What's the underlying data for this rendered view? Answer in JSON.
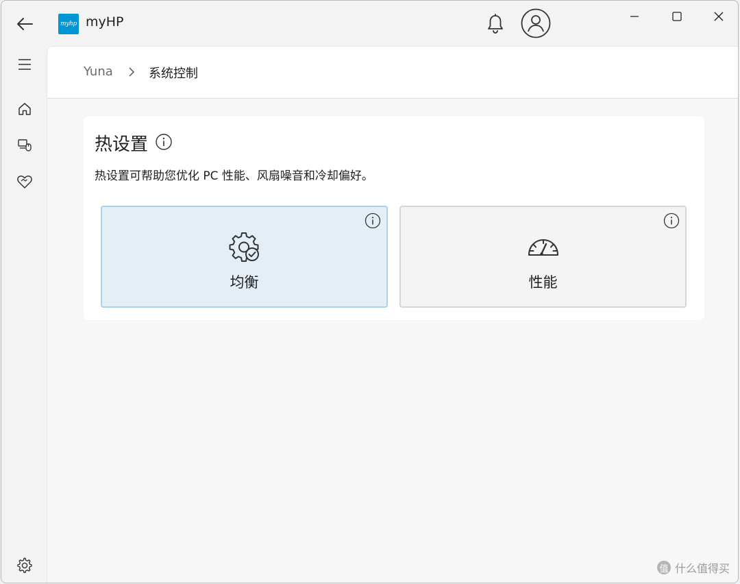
{
  "app": {
    "title": "myHP",
    "logo_text": "myhp",
    "brand_color": "#0096d6"
  },
  "titlebar": {
    "back_icon": "arrow-left-icon",
    "notification_icon": "bell-icon",
    "account_icon": "user-circle-icon",
    "window_controls": [
      "minimize-icon",
      "maximize-icon",
      "close-icon"
    ]
  },
  "sidebar": {
    "items": [
      {
        "icon": "hamburger-menu-icon"
      },
      {
        "icon": "home-icon"
      },
      {
        "icon": "devices-icon"
      },
      {
        "icon": "support-heart-icon"
      },
      {
        "icon": "gear-icon"
      }
    ]
  },
  "breadcrumb": {
    "root": "Yuna",
    "current": "系统控制"
  },
  "thermal": {
    "title": "热设置",
    "description": "热设置可帮助您优化 PC 性能、风扇噪音和冷却偏好。",
    "modes": [
      {
        "label": "均衡",
        "icon": "gear-check-icon",
        "selected": true,
        "accent": "#a6d4ee"
      },
      {
        "label": "性能",
        "icon": "speedometer-icon",
        "selected": false
      }
    ]
  },
  "watermark": {
    "text": "什么值得买",
    "badge": "值"
  }
}
